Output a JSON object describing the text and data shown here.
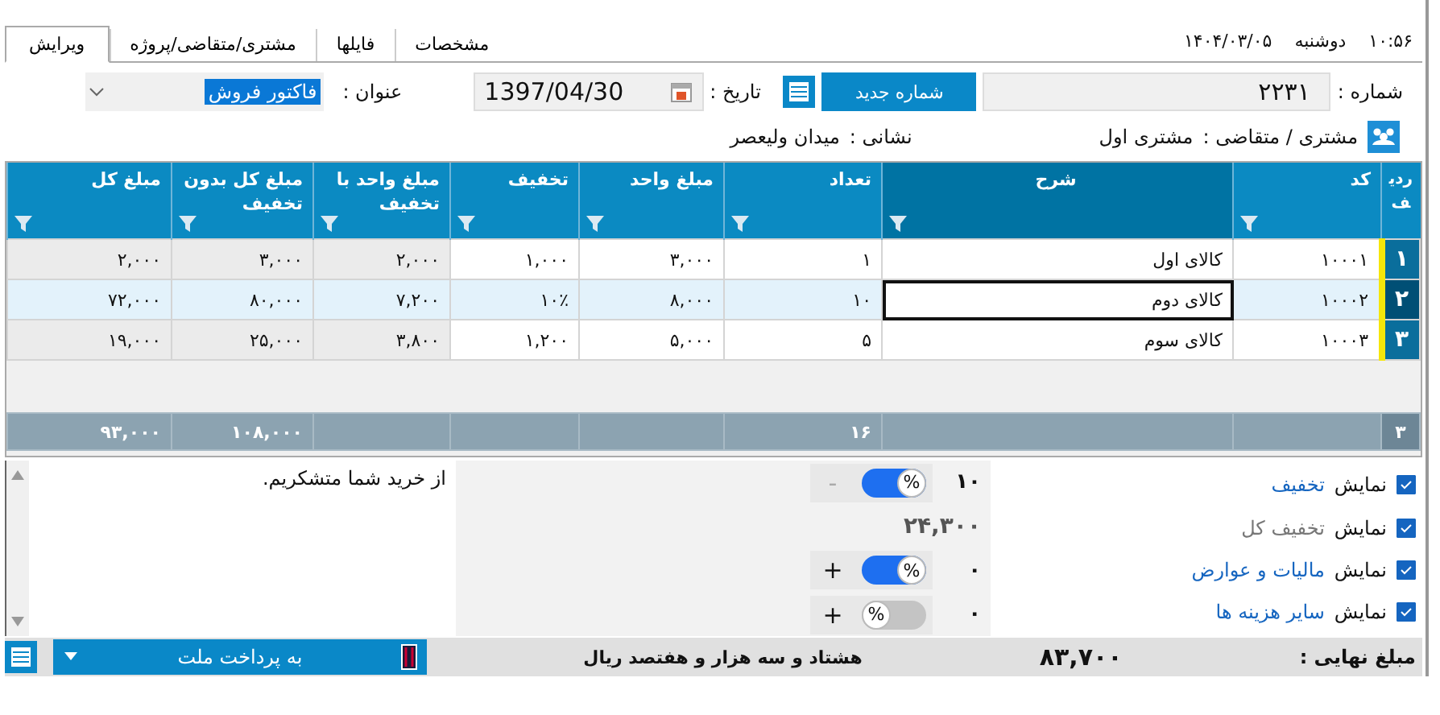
{
  "header": {
    "time": "۱۰:۵۶",
    "weekday": "دوشنبه",
    "date": "۱۴۰۴/۰۳/۰۵"
  },
  "tabs": [
    {
      "label": "مشخصات",
      "selected": false
    },
    {
      "label": "فایلها",
      "selected": false
    },
    {
      "label": "مشتری/متقاضی/پروژه",
      "selected": false
    },
    {
      "label": "ویرایش",
      "selected": true
    }
  ],
  "form": {
    "number_label": "شماره :",
    "number": "۲۲۳۱",
    "new_number_button": "شماره جدید",
    "date_label": "تاریخ :",
    "date": "1397/04/30",
    "title_label": "عنوان :",
    "title": "فاکتور فروش",
    "customer_label": "مشتری / متقاضی :",
    "customer": "مشتری اول",
    "address_label": "نشانی :",
    "address": "میدان ولیعصر"
  },
  "table": {
    "columns": [
      {
        "label": "ردیف",
        "selected": false,
        "computed": false,
        "filter": false,
        "total": "۳"
      },
      {
        "label": "کد",
        "selected": false,
        "computed": false,
        "filter": true
      },
      {
        "label": "شرح",
        "selected": true,
        "computed": false,
        "filter": true
      },
      {
        "label": "تعداد",
        "selected": false,
        "computed": false,
        "filter": true,
        "total": "۱۶"
      },
      {
        "label": "مبلغ واحد",
        "selected": false,
        "computed": false,
        "filter": true
      },
      {
        "label": "تخفیف",
        "selected": false,
        "computed": false,
        "filter": true
      },
      {
        "label": "مبلغ واحد  با تخفیف",
        "selected": false,
        "computed": true,
        "filter": true
      },
      {
        "label": "مبلغ کل بدون تخفیف",
        "selected": false,
        "computed": true,
        "filter": true,
        "total": "۱۰۸,۰۰۰"
      },
      {
        "label": "مبلغ کل",
        "selected": false,
        "computed": true,
        "filter": true,
        "total": "۹۳,۰۰۰"
      }
    ],
    "rows": [
      {
        "selected": false,
        "cells": [
          "۱",
          "۱۰۰۰۱",
          "کالای اول",
          "۱",
          "۳,۰۰۰",
          "۱,۰۰۰",
          "۲,۰۰۰",
          "۳,۰۰۰",
          "۲,۰۰۰"
        ]
      },
      {
        "selected": true,
        "cells": [
          "۲",
          "۱۰۰۰۲",
          "کالای دوم",
          "۱۰",
          "۸,۰۰۰",
          "۱۰٪",
          "۷,۲۰۰",
          "۸۰,۰۰۰",
          "۷۲,۰۰۰"
        ]
      },
      {
        "selected": false,
        "cells": [
          "۳",
          "۱۰۰۰۳",
          "کالای سوم",
          "۵",
          "۵,۰۰۰",
          "۱,۲۰۰",
          "۳,۸۰۰",
          "۲۵,۰۰۰",
          "۱۹,۰۰۰"
        ]
      }
    ]
  },
  "options": [
    {
      "prefix": "نمایش",
      "label": "تخفیف",
      "checked": true,
      "disabled": false
    },
    {
      "prefix": "نمایش",
      "label": "تخفیف کل",
      "checked": true,
      "disabled": true
    },
    {
      "prefix": "نمایش",
      "label": "مالیات  و عوارض",
      "checked": true,
      "disabled": false
    },
    {
      "prefix": "نمایش",
      "label": "سایر هزینه ها",
      "checked": true,
      "disabled": false
    }
  ],
  "adjustments": [
    {
      "kind": "toggle",
      "value": "۱۰",
      "toggle_label": "%",
      "on": true,
      "button": "-",
      "button_disabled": true
    },
    {
      "kind": "sum",
      "value": "۲۴,۳۰۰"
    },
    {
      "kind": "toggle",
      "value": "۰",
      "toggle_label": "%",
      "on": true,
      "button": "+",
      "button_disabled": false
    },
    {
      "kind": "toggle",
      "value": "۰",
      "toggle_label": "%",
      "on": false,
      "button": "+",
      "button_disabled": false
    }
  ],
  "note": "از خرید شما متشکریم.",
  "footer": {
    "final_label": "مبلغ نهایی :",
    "final_amount": "۸۳,۷۰۰",
    "amount_words": "هشتاد و سه هزار و هفتصد ریال",
    "payment": "به پرداخت ملت"
  }
}
